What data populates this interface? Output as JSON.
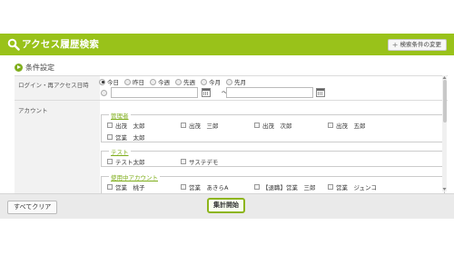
{
  "header": {
    "title": "アクセス履歴検索",
    "change_button": "検索条件の変更"
  },
  "conditions": {
    "section_title": "条件設定",
    "login_label": "ログイン・再アクセス日時",
    "period_options": [
      "今日",
      "昨日",
      "今週",
      "先週",
      "今月",
      "先月"
    ],
    "selected_period": "今日",
    "date_from": "",
    "date_to": "",
    "range_separator": "～",
    "account_label": "アカウント",
    "groups": [
      {
        "name": "管理者",
        "accounts": [
          "出茂　太郎",
          "出茂　三郎",
          "出茂　次郎",
          "出茂　五郎",
          "営業　太郎"
        ]
      },
      {
        "name": "テスト",
        "accounts": [
          "テスト太郎",
          "サステデモ"
        ]
      },
      {
        "name": "使用中アカウント",
        "accounts": [
          "営業　桃子",
          "営業　あきらA",
          "【退職】営業　三郎",
          "営業　ジュンコ"
        ]
      }
    ]
  },
  "footer": {
    "clear_button": "すべてクリア",
    "run_button": "集計開始"
  },
  "colors": {
    "accent": "#99c21a",
    "link": "#7fae1c"
  }
}
